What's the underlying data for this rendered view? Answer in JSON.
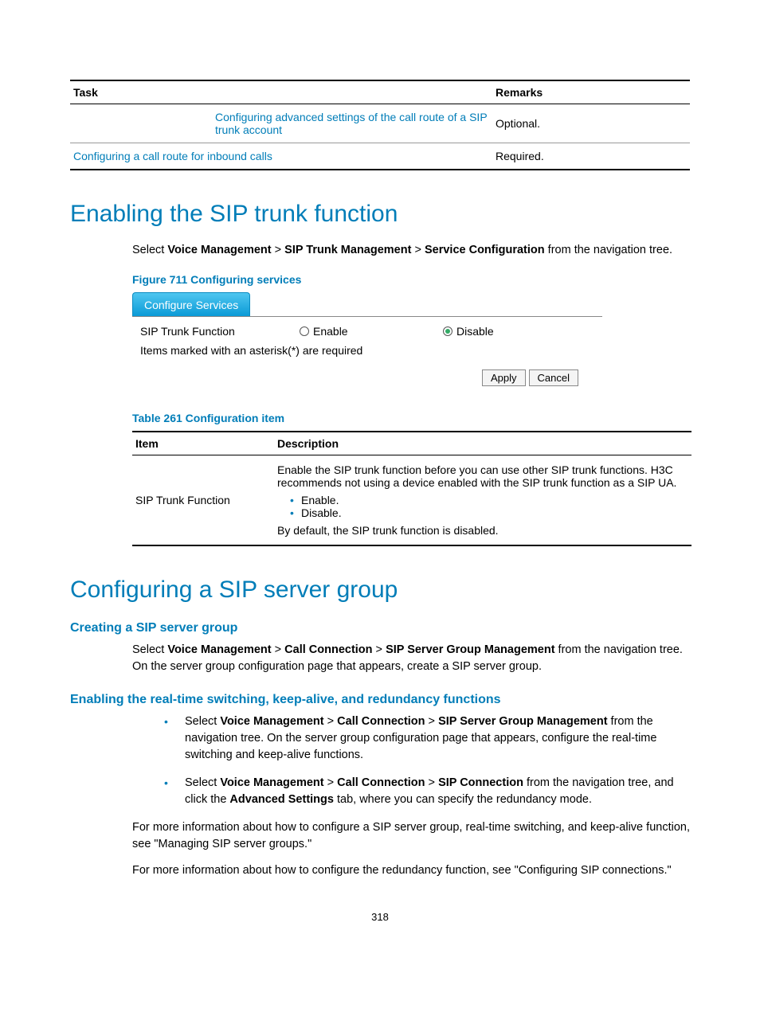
{
  "top_table": {
    "headers": {
      "task": "Task",
      "remarks": "Remarks"
    },
    "rows": [
      {
        "task_left": "",
        "task_mid": "Configuring advanced settings of the call route of a SIP trunk account",
        "remarks": "Optional."
      },
      {
        "task_left": "Configuring a call route for inbound calls",
        "task_mid": "",
        "remarks": "Required."
      }
    ]
  },
  "h1_enable": "Enabling the SIP trunk function",
  "nav1_prefix": "Select ",
  "nav1_a": "Voice Management",
  "nav_sep": " > ",
  "nav1_b": "SIP Trunk Management",
  "nav1_c": "Service Configuration",
  "nav1_suffix": " from the navigation tree.",
  "fig_caption": "Figure 711 Configuring services",
  "fig": {
    "tab": "Configure Services",
    "row_label": "SIP Trunk Function",
    "opt_enable": "Enable",
    "opt_disable": "Disable",
    "note": "Items marked with an asterisk(*) are required",
    "btn_apply": "Apply",
    "btn_cancel": "Cancel"
  },
  "tbl_caption": "Table 261 Configuration item",
  "desc_table": {
    "headers": {
      "item": "Item",
      "desc": "Description"
    },
    "row": {
      "item": "SIP Trunk Function",
      "p1": "Enable the SIP trunk function before you can use other SIP trunk functions. H3C recommends not using a device enabled with the SIP trunk function as a SIP UA.",
      "b1": "Enable.",
      "b2": "Disable.",
      "p2": "By default, the SIP trunk function is disabled."
    }
  },
  "h1_config": "Configuring a SIP server group",
  "sub_create": "Creating a SIP server group",
  "create_prefix": "Select ",
  "create_a": "Voice Management",
  "create_b": "Call Connection",
  "create_c": "SIP Server Group Management",
  "create_suffix": " from the navigation tree. On the server group configuration page that appears, create a SIP server group.",
  "sub_enable_rt": "Enabling the real-time switching, keep-alive, and redundancy functions",
  "li1": {
    "prefix": "Select ",
    "a": "Voice Management",
    "b": "Call Connection",
    "c": "SIP Server Group Management",
    "suffix": " from the navigation tree. On the server group configuration page that appears, configure the real-time switching and keep-alive functions."
  },
  "li2": {
    "prefix": "Select ",
    "a": "Voice Management",
    "b": "Call Connection",
    "c": "SIP Connection",
    "mid": " from the navigation tree, and click the ",
    "d": "Advanced Settings",
    "suffix": " tab, where you can specify the redundancy mode."
  },
  "para1": "For more information about how to configure a SIP server group, real-time switching, and keep-alive function, see \"Managing SIP server groups.\"",
  "para2": "For more information about how to configure the redundancy function, see \"Configuring SIP connections.\"",
  "page_number": "318"
}
